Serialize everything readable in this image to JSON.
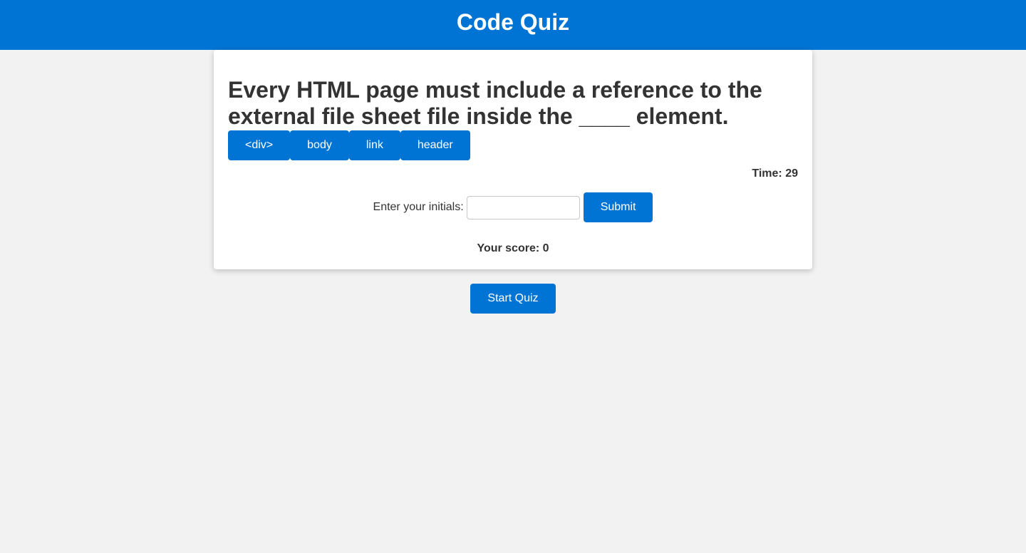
{
  "header": {
    "title": "Code Quiz"
  },
  "quiz": {
    "question": "Every HTML page must include a reference to the external file sheet file inside the ____ element.",
    "choices": [
      "<div>",
      "body",
      "link",
      "header"
    ],
    "timer_label": "Time: 29",
    "initials_label": "Enter your initials:",
    "initials_value": "",
    "submit_label": "Submit",
    "score_label": "Your score: 0"
  },
  "start_button_label": "Start Quiz",
  "colors": {
    "accent": "#0074d4",
    "background": "#f2f2f2",
    "text": "#333333"
  }
}
